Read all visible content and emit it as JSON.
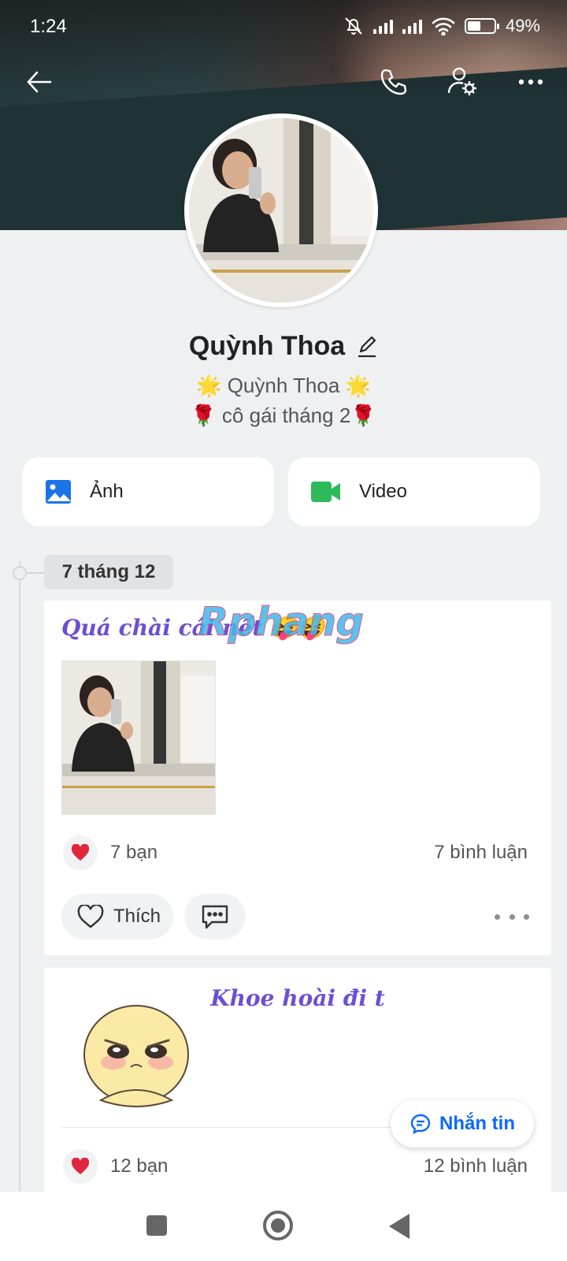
{
  "status_bar": {
    "time": "1:24",
    "battery_percent": "49%",
    "battery_level": 0.49
  },
  "profile": {
    "name": "Quỳnh Thoa",
    "bio_line1": "🌟 Quỳnh Thoa 🌟",
    "bio_line2": "🌹 cô gái tháng 2🌹"
  },
  "media": {
    "photos_label": "Ảnh",
    "videos_label": "Video"
  },
  "timeline": {
    "date_label": "7 tháng 12"
  },
  "posts": [
    {
      "caption": "Quá chài cái nết 😝😝",
      "reactions": "7 bạn",
      "comments": "7 bình luận",
      "like_label": "Thích"
    },
    {
      "caption": "Khoe hoài đi t",
      "reactions": "12 bạn",
      "comments": "12 bình luận"
    }
  ],
  "watermark": "Rphang",
  "message_button": "Nhắn tin",
  "colors": {
    "accent_blue": "#0a68ff",
    "caption_purple": "#6c4fd3",
    "heart_red": "#e0263c",
    "video_green": "#2fba5a",
    "photo_blue": "#1a73e8"
  },
  "icons": [
    "back-arrow-icon",
    "phone-icon",
    "user-settings-icon",
    "more-icon",
    "image-icon",
    "video-camera-icon",
    "edit-pencil-icon",
    "heart-icon",
    "comment-icon",
    "message-icon"
  ]
}
